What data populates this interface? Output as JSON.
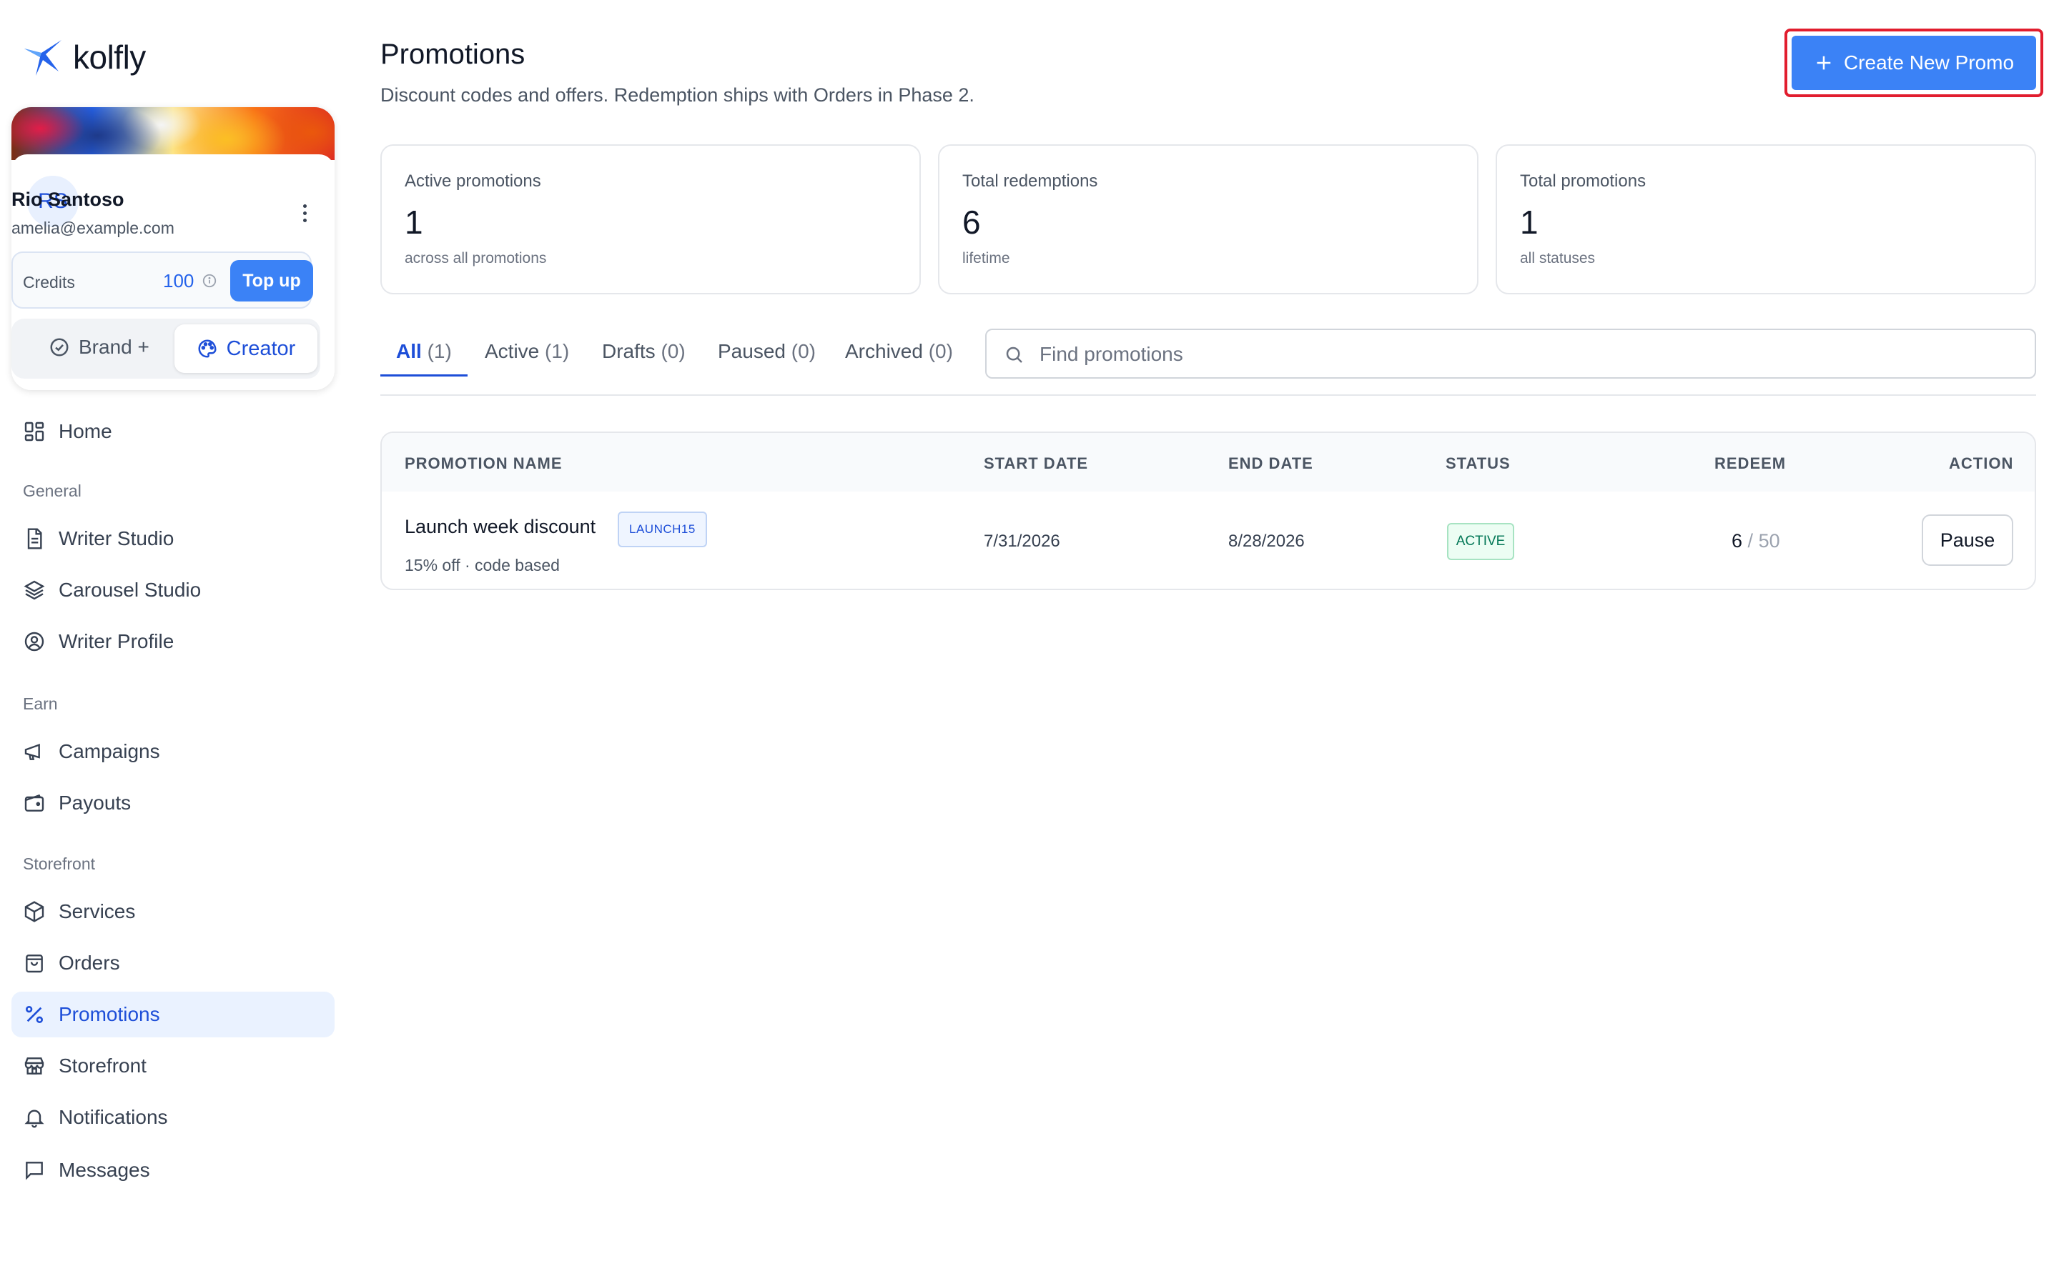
{
  "brand": {
    "name": "kolfly",
    "accent": "#3b82f6"
  },
  "profile": {
    "initials": "RS",
    "name": "Rio Santoso",
    "email": "amelia@example.com",
    "credits_label": "Credits",
    "credits_value": "100",
    "topup_label": "Top up",
    "mode_brand_label": "Brand +",
    "mode_creator_label": "Creator"
  },
  "nav": {
    "home": "Home",
    "sections": {
      "general": "General",
      "earn": "Earn",
      "storefront": "Storefront"
    },
    "writer_studio": "Writer Studio",
    "carousel_studio": "Carousel Studio",
    "writer_profile": "Writer Profile",
    "campaigns": "Campaigns",
    "payouts": "Payouts",
    "services": "Services",
    "orders": "Orders",
    "promotions": "Promotions",
    "storefront": "Storefront",
    "notifications": "Notifications",
    "messages": "Messages"
  },
  "header": {
    "title": "Promotions",
    "subtitle": "Discount codes and offers. Redemption ships with Orders in Phase 2.",
    "create_label": "Create New Promo"
  },
  "stats": [
    {
      "label": "Active promotions",
      "value": "1",
      "caption": "across all promotions"
    },
    {
      "label": "Total redemptions",
      "value": "6",
      "caption": "lifetime"
    },
    {
      "label": "Total promotions",
      "value": "1",
      "caption": "all statuses"
    }
  ],
  "tabs": [
    {
      "label": "All",
      "count": "(1)"
    },
    {
      "label": "Active",
      "count": "(1)"
    },
    {
      "label": "Drafts",
      "count": "(0)"
    },
    {
      "label": "Paused",
      "count": "(0)"
    },
    {
      "label": "Archived",
      "count": "(0)"
    }
  ],
  "search": {
    "placeholder": "Find promotions",
    "value": ""
  },
  "table": {
    "columns": [
      "PROMOTION NAME",
      "START DATE",
      "END DATE",
      "STATUS",
      "REDEEM",
      "ACTION"
    ],
    "rows": [
      {
        "name": "Launch week discount",
        "code": "LAUNCH15",
        "description": "15% off · code based",
        "start_date": "7/31/2026",
        "end_date": "8/28/2026",
        "status": "ACTIVE",
        "redeemed": "6",
        "separator": "/",
        "limit": "50",
        "action": "Pause"
      }
    ]
  }
}
